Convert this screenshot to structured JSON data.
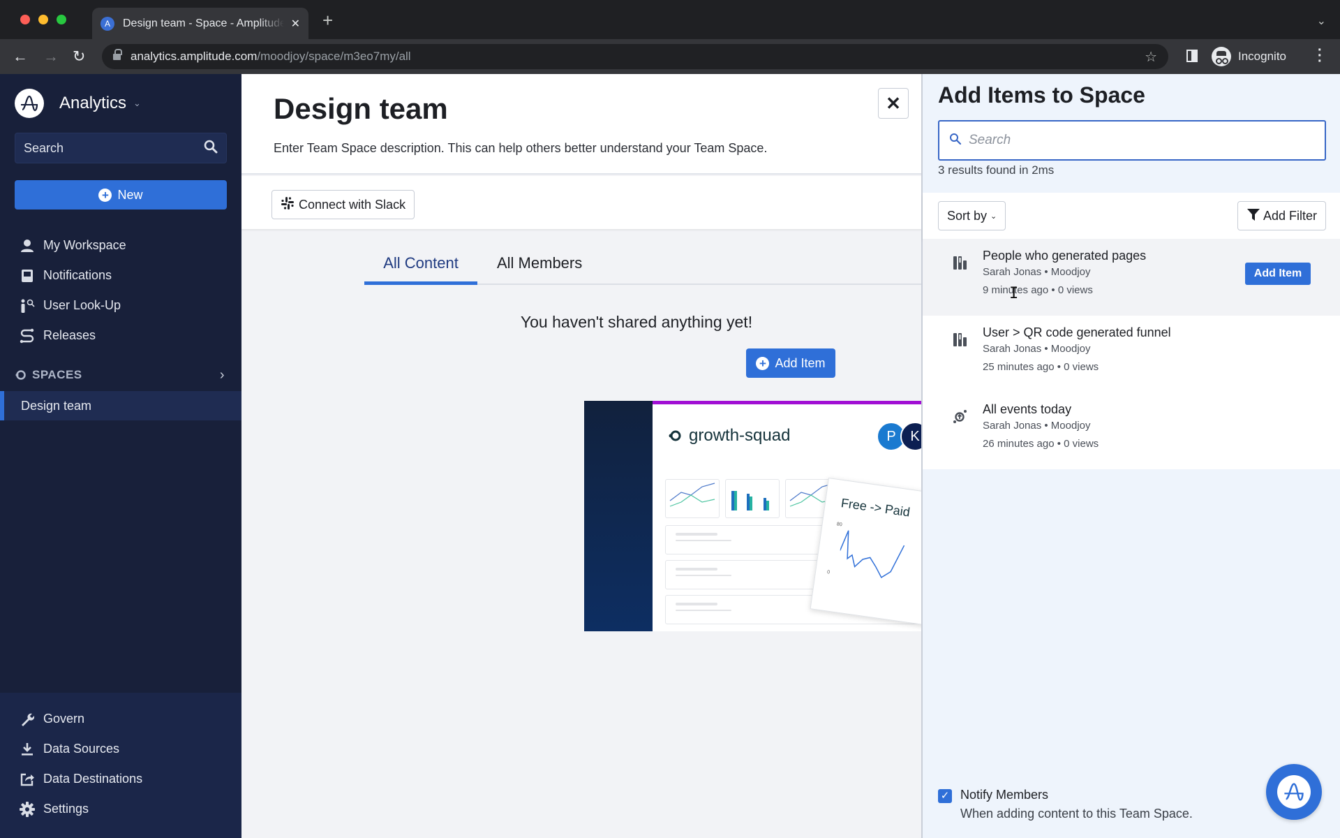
{
  "browser": {
    "tab_title": "Design team - Space - Amplitude",
    "url_host": "analytics.amplitude.com",
    "url_path": "/moodjoy/space/m3eo7my/all",
    "profile_label": "Incognito"
  },
  "sidebar": {
    "app_name": "Analytics",
    "search_placeholder": "Search",
    "new_label": "New",
    "nav_items": [
      {
        "label": "My Workspace",
        "icon": "user-icon"
      },
      {
        "label": "Notifications",
        "icon": "inbox-icon"
      },
      {
        "label": "User Look-Up",
        "icon": "user-search-icon"
      },
      {
        "label": "Releases",
        "icon": "releases-icon"
      }
    ],
    "spaces_header": "SPACES",
    "spaces": [
      {
        "label": "Design team",
        "active": true
      }
    ],
    "bottom_items": [
      {
        "label": "Govern",
        "icon": "wrench-icon"
      },
      {
        "label": "Data Sources",
        "icon": "download-icon"
      },
      {
        "label": "Data Destinations",
        "icon": "share-icon"
      },
      {
        "label": "Settings",
        "icon": "gear-icon"
      }
    ]
  },
  "main": {
    "title": "Design team",
    "description": "Enter Team Space description. This can help others better understand your Team Space.",
    "slack_button": "Connect with Slack",
    "tabs": [
      {
        "label": "All Content",
        "active": true
      },
      {
        "label": "All Members",
        "active": false
      }
    ],
    "empty_message": "You haven't shared anything yet!",
    "add_item_label": "Add Item",
    "preview": {
      "space_name": "growth-squad",
      "avatars": [
        {
          "initial": "P",
          "color": "#1a7ad0"
        },
        {
          "initial": "K",
          "color": "#0c1f52"
        }
      ],
      "float_title": "Free -> Paid",
      "float_axis": [
        "80",
        "0"
      ]
    }
  },
  "panel": {
    "title": "Add Items to Space",
    "search_placeholder": "Search",
    "search_value": "",
    "results_count": "3 results found in 2ms",
    "sort_label": "Sort by",
    "filter_label": "Add Filter",
    "results": [
      {
        "title": "People who generated pages",
        "owner": "Sarah Jonas • Moodjoy",
        "meta": "9 minutes ago • 0 views",
        "icon": "chart-bars-icon",
        "hovered": true,
        "action": "Add Item"
      },
      {
        "title": "User > QR code generated funnel",
        "owner": "Sarah Jonas • Moodjoy",
        "meta": "25 minutes ago • 0 views",
        "icon": "chart-bars-icon",
        "hovered": false
      },
      {
        "title": "All events today",
        "owner": "Sarah Jonas • Moodjoy",
        "meta": "26 minutes ago • 0 views",
        "icon": "event-segmentation-icon",
        "hovered": false
      }
    ],
    "notify": {
      "checked": true,
      "label": "Notify Members",
      "sublabel": "When adding content to this Team Space."
    }
  },
  "colors": {
    "primary": "#2f6fd8",
    "sidebar_bg": "#18203a",
    "panel_bg": "#eef4fc"
  }
}
